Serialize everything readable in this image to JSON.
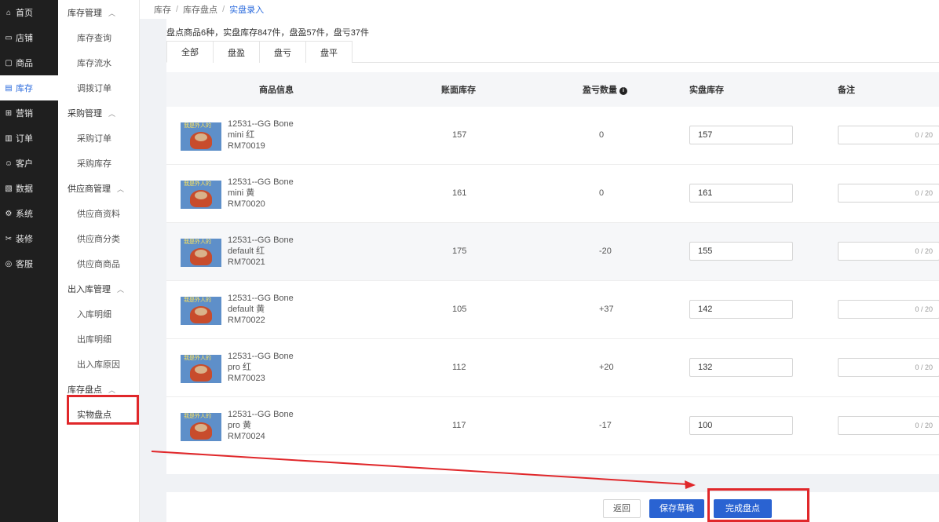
{
  "nav": {
    "items": [
      {
        "icon": "home-icon",
        "glyph": "⌂",
        "label": "首页"
      },
      {
        "icon": "store-icon",
        "glyph": "▭",
        "label": "店铺"
      },
      {
        "icon": "product-icon",
        "glyph": "▢",
        "label": "商品"
      },
      {
        "icon": "inventory-icon",
        "glyph": "▤",
        "label": "库存"
      },
      {
        "icon": "gift-icon",
        "glyph": "⊞",
        "label": "营销"
      },
      {
        "icon": "order-icon",
        "glyph": "▥",
        "label": "订单"
      },
      {
        "icon": "customer-icon",
        "glyph": "☺",
        "label": "客户"
      },
      {
        "icon": "data-icon",
        "glyph": "▧",
        "label": "数据"
      },
      {
        "icon": "settings-icon",
        "glyph": "⚙",
        "label": "系统"
      },
      {
        "icon": "decorate-icon",
        "glyph": "✂",
        "label": "装修"
      },
      {
        "icon": "chat-icon",
        "glyph": "◎",
        "label": "客服"
      }
    ],
    "active_index": 3
  },
  "subnav": {
    "stock_mgmt": "库存管理",
    "stock_query": "库存查询",
    "stock_flow": "库存流水",
    "transfer_order": "调拨订单",
    "purchase_mgmt": "采购管理",
    "purchase_order": "采购订单",
    "purchase_stock": "采购库存",
    "supplier_mgmt": "供应商管理",
    "supplier_info": "供应商资料",
    "supplier_category": "供应商分类",
    "supplier_goods": "供应商商品",
    "inout_mgmt": "出入库管理",
    "in_detail": "入库明细",
    "out_detail": "出库明细",
    "inout_reason": "出入库原因",
    "stocktake": "库存盘点",
    "physical_count": "实物盘点"
  },
  "breadcrumb": {
    "a": "库存",
    "b": "库存盘点",
    "c": "实盘录入"
  },
  "summary": "盘点商品6种，实盘库存847件，盘盈57件，盘亏37件",
  "tabs": [
    "全部",
    "盘盈",
    "盘亏",
    "盘平"
  ],
  "table": {
    "headers": {
      "product": "商品信息",
      "book": "账面库存",
      "diff": "盈亏数量",
      "actual": "实盘库存",
      "note": "备注"
    },
    "thumb_caption": "我是外人的",
    "rows": [
      {
        "name1": "12531--GG Bone",
        "name2": "mini 红",
        "sku": "RM70019",
        "book": "157",
        "diff": "0",
        "actual": "157",
        "note": "0 / 20"
      },
      {
        "name1": "12531--GG Bone",
        "name2": "mini 黄",
        "sku": "RM70020",
        "book": "161",
        "diff": "0",
        "actual": "161",
        "note": "0 / 20"
      },
      {
        "name1": "12531--GG Bone",
        "name2": "default 红",
        "sku": "RM70021",
        "book": "175",
        "diff": "-20",
        "actual": "155",
        "note": "0 / 20"
      },
      {
        "name1": "12531--GG Bone",
        "name2": "default 黄",
        "sku": "RM70022",
        "book": "105",
        "diff": "+37",
        "actual": "142",
        "note": "0 / 20"
      },
      {
        "name1": "12531--GG Bone",
        "name2": "pro 红",
        "sku": "RM70023",
        "book": "112",
        "diff": "+20",
        "actual": "132",
        "note": "0 / 20"
      },
      {
        "name1": "12531--GG Bone",
        "name2": "pro 黄",
        "sku": "RM70024",
        "book": "117",
        "diff": "-17",
        "actual": "100",
        "note": "0 / 20"
      }
    ]
  },
  "footer": {
    "back": "返回",
    "save_draft": "保存草稿",
    "complete": "完成盘点"
  },
  "colors": {
    "accent": "#2a63d2",
    "highlight": "#e0272a",
    "sidebar": "#1f1f1f"
  }
}
